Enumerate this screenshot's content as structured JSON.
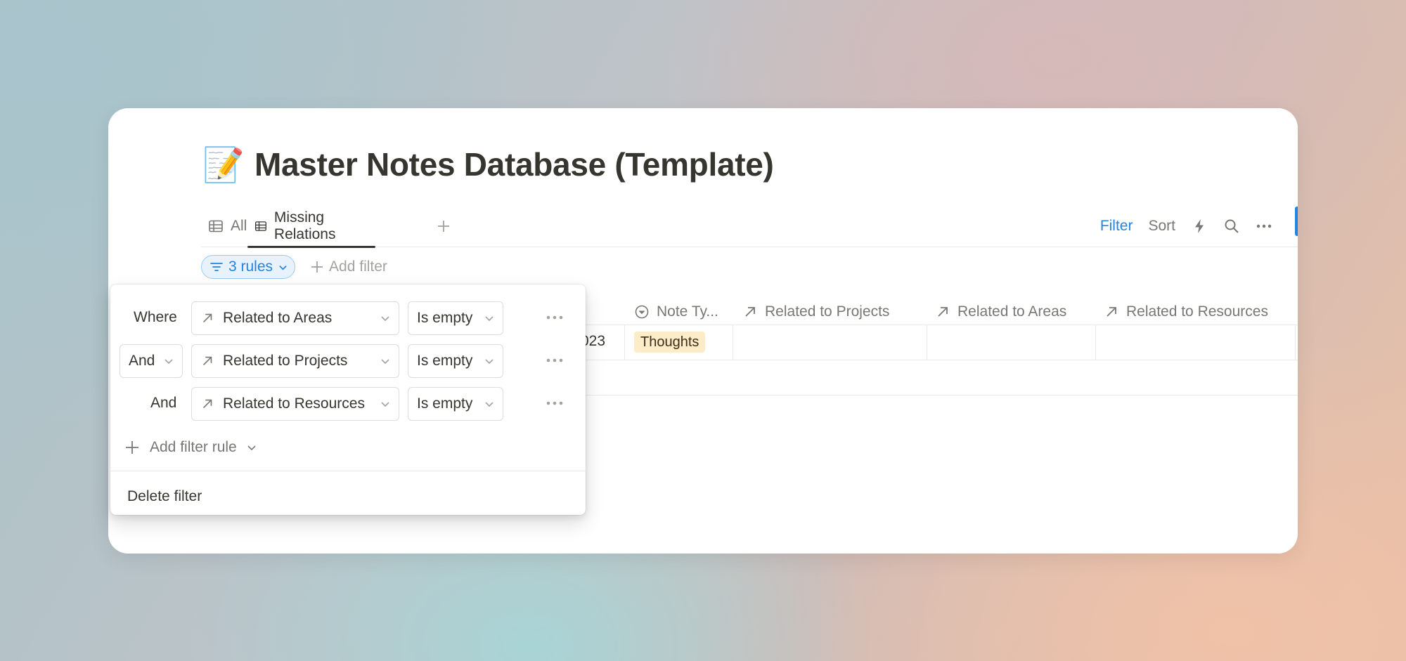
{
  "page": {
    "emoji": "📝",
    "title": "Master Notes Database (Template)"
  },
  "tabs": [
    {
      "label": "All",
      "icon": "table-icon"
    },
    {
      "label": "Missing Relations",
      "icon": "table-icon",
      "active": true
    }
  ],
  "toolbar": {
    "filter_label": "Filter",
    "sort_label": "Sort"
  },
  "filter_bar": {
    "rules_chip": "3 rules",
    "add_filter": "Add filter"
  },
  "table": {
    "columns": [
      {
        "label": "Note Ty...",
        "icon": "select-circle-icon"
      },
      {
        "label": "Related to Projects",
        "icon": "relation-arrow-icon"
      },
      {
        "label": "Related to Areas",
        "icon": "relation-arrow-icon"
      },
      {
        "label": "Related to Resources",
        "icon": "relation-arrow-icon"
      }
    ],
    "rows": [
      {
        "date_fragment": "023",
        "note_type": "Thoughts"
      }
    ]
  },
  "filter_popover": {
    "rules": [
      {
        "conjunction": "Where",
        "property": "Related to Areas",
        "operator": "Is empty"
      },
      {
        "conjunction": "And",
        "property": "Related to Projects",
        "operator": "Is empty",
        "conjunction_select": true
      },
      {
        "conjunction": "And",
        "property": "Related to Resources",
        "operator": "Is empty"
      }
    ],
    "add_rule": "Add filter rule",
    "delete": "Delete filter"
  },
  "colors": {
    "accent": "#2383e2",
    "tag_bg": "#fdecc8",
    "text": "#37352f",
    "muted": "#787774"
  }
}
